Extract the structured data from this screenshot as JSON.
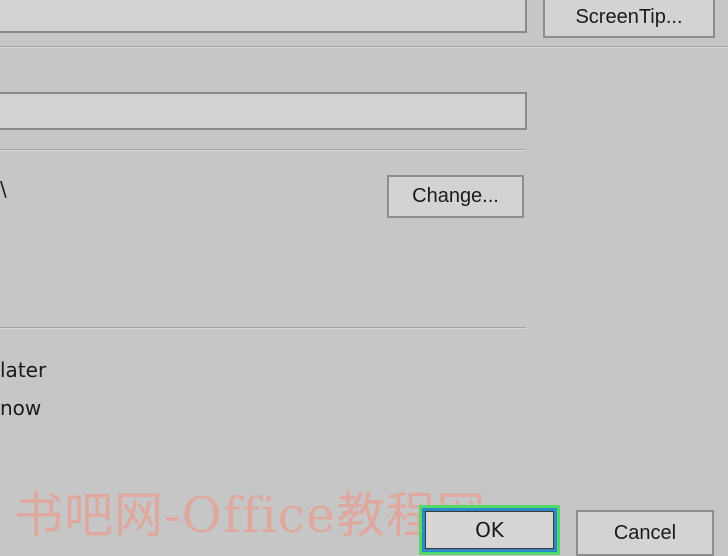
{
  "fields": {
    "top_value": "",
    "mid_value": ""
  },
  "buttons": {
    "screentip_label": "ScreenTip...",
    "change_label": "Change...",
    "ok_label": "OK",
    "cancel_label": "Cancel"
  },
  "path_fragment": "\\",
  "options": {
    "later_label": "later",
    "now_label": "now"
  },
  "watermark_text": "书吧网-Office教程网",
  "colors": {
    "dialog_bg": "#c6c6c6",
    "focus_outline": "#53d96a",
    "focus_ring": "#2d8ac7",
    "watermark": "#e4a296"
  }
}
